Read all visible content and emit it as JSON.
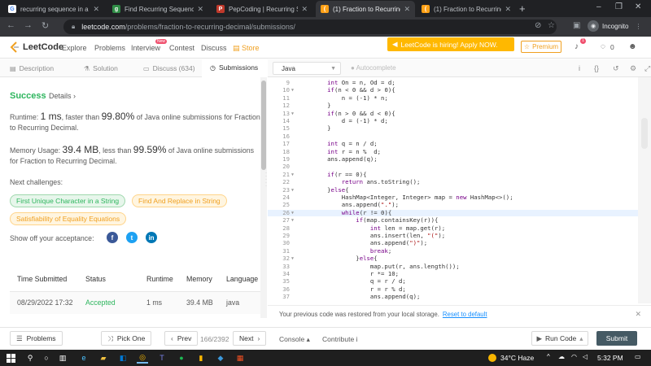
{
  "browser": {
    "tabs": [
      {
        "title": "recurring sequence in a fr",
        "active": false,
        "favicon": "google-icon"
      },
      {
        "title": "Find Recurring Sequence",
        "active": false,
        "favicon": "gfg-icon"
      },
      {
        "title": "PepCoding | Recurring Se",
        "active": false,
        "favicon": "pepcoding-icon"
      },
      {
        "title": "(1) Fraction to Recurring D",
        "active": true,
        "favicon": "leetcode-icon"
      },
      {
        "title": "(1) Fraction to Recurring D",
        "active": false,
        "favicon": "leetcode-icon"
      }
    ],
    "url_host": "leetcode.com",
    "url_path": "/problems/fraction-to-recurring-decimal/submissions/",
    "profile_label": "Incognito"
  },
  "header": {
    "logo_text": "LeetCode",
    "nav": [
      "Explore",
      "Problems",
      "Interview",
      "Contest",
      "Discuss",
      "Store"
    ],
    "new_badge": "New",
    "hiring_text": "LeetCode is hiring! Apply NOW.",
    "premium_label": "Premium",
    "notif_count": "1",
    "coins": "0"
  },
  "left_tabs": [
    "Description",
    "Solution",
    "Discuss (634)",
    "Submissions"
  ],
  "result": {
    "status": "Success",
    "details_label": "Details",
    "runtime_prefix": "Runtime: ",
    "runtime_value": "1 ms",
    "runtime_mid": ", faster than ",
    "runtime_pct": "99.80%",
    "runtime_suffix": " of Java online submissions for Fraction to Recurring Decimal.",
    "memory_prefix": "Memory Usage: ",
    "memory_value": "39.4 MB",
    "memory_mid": ", less than ",
    "memory_pct": "99.59%",
    "memory_suffix": " of Java online submissions for Fraction to Recurring Decimal.",
    "next_label": "Next challenges:",
    "challenges": [
      {
        "label": "First Unique Character in a String",
        "difficulty": "easy"
      },
      {
        "label": "Find And Replace in String",
        "difficulty": "medium"
      },
      {
        "label": "Satisfiability of Equality Equations",
        "difficulty": "medium"
      }
    ],
    "showoff_label": "Show off your acceptance:"
  },
  "submissions": {
    "columns": [
      "Time Submitted",
      "Status",
      "Runtime",
      "Memory",
      "Language"
    ],
    "rows": [
      [
        "08/29/2022 17:32",
        "Accepted",
        "1 ms",
        "39.4 MB",
        "java"
      ]
    ]
  },
  "editor": {
    "language": "Java",
    "autocomplete_label": "Autocomplete",
    "highlight_line": 26,
    "lines": [
      {
        "n": "9",
        "fold": false,
        "code": "        int On = n, Od = d;"
      },
      {
        "n": "10",
        "fold": true,
        "code": "        if(n < 0 && d > 0){"
      },
      {
        "n": "11",
        "fold": false,
        "code": "            n = (-1) * n;"
      },
      {
        "n": "12",
        "fold": false,
        "code": "        }"
      },
      {
        "n": "13",
        "fold": true,
        "code": "        if(n > 0 && d < 0){"
      },
      {
        "n": "14",
        "fold": false,
        "code": "            d = (-1) * d;"
      },
      {
        "n": "15",
        "fold": false,
        "code": "        }"
      },
      {
        "n": "16",
        "fold": false,
        "code": ""
      },
      {
        "n": "17",
        "fold": false,
        "code": "        int q = n / d;"
      },
      {
        "n": "18",
        "fold": false,
        "code": "        int r = n %  d;"
      },
      {
        "n": "19",
        "fold": false,
        "code": "        ans.append(q);"
      },
      {
        "n": "20",
        "fold": false,
        "code": ""
      },
      {
        "n": "21",
        "fold": true,
        "code": "        if(r == 0){"
      },
      {
        "n": "22",
        "fold": false,
        "code": "            return ans.toString();"
      },
      {
        "n": "23",
        "fold": true,
        "code": "        }else{"
      },
      {
        "n": "24",
        "fold": false,
        "code": "            HashMap<Integer, Integer> map = new HashMap<>();"
      },
      {
        "n": "25",
        "fold": false,
        "code": "            ans.append(\".\");"
      },
      {
        "n": "26",
        "fold": true,
        "code": "            while(r != 0){"
      },
      {
        "n": "27",
        "fold": true,
        "code": "                if(map.containsKey(r)){"
      },
      {
        "n": "28",
        "fold": false,
        "code": "                    int len = map.get(r);"
      },
      {
        "n": "29",
        "fold": false,
        "code": "                    ans.insert(len, \"(\");"
      },
      {
        "n": "30",
        "fold": false,
        "code": "                    ans.append(\")\");"
      },
      {
        "n": "31",
        "fold": false,
        "code": "                    break;"
      },
      {
        "n": "32",
        "fold": true,
        "code": "                }else{"
      },
      {
        "n": "33",
        "fold": false,
        "code": "                    map.put(r, ans.length());"
      },
      {
        "n": "34",
        "fold": false,
        "code": "                    r *= 10;"
      },
      {
        "n": "35",
        "fold": false,
        "code": "                    q = r / d;"
      },
      {
        "n": "36",
        "fold": false,
        "code": "                    r = r % d;"
      },
      {
        "n": "37",
        "fold": false,
        "code": "                    ans.append(q);"
      }
    ],
    "restored_text": "Your previous code was restored from your local storage.",
    "restored_link": "Reset to default"
  },
  "footer": {
    "problems_label": "Problems",
    "pickone_label": "Pick One",
    "prev_label": "Prev",
    "page_count": "166/2392",
    "next_label": "Next",
    "console_label": "Console",
    "contribute_label": "Contribute",
    "runcode_label": "Run Code",
    "submit_label": "Submit"
  },
  "taskbar": {
    "weather": "34°C  Haze",
    "lang": "ENG",
    "time": "5:32 PM"
  },
  "colors": {
    "accent_green": "#2db55d",
    "accent_orange": "#f0a020",
    "submit_bg": "#455a64"
  }
}
